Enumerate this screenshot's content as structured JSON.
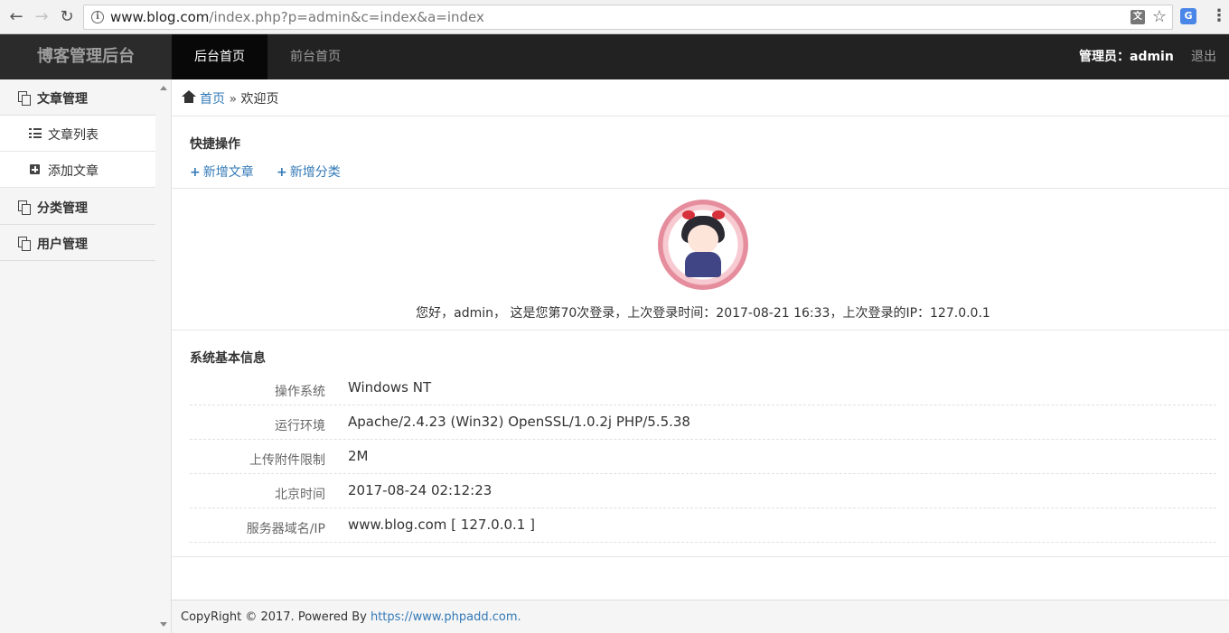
{
  "browser": {
    "url_host": "www.blog.com",
    "url_path": "/index.php?p=admin&c=index&a=index"
  },
  "header": {
    "brand": "博客管理后台",
    "nav": [
      {
        "label": "后台首页"
      },
      {
        "label": "前台首页"
      }
    ],
    "user": "管理员：admin",
    "logout": "退出"
  },
  "sidebar": {
    "groups": [
      {
        "label": "文章管理",
        "items": [
          {
            "label": "文章列表"
          },
          {
            "label": "添加文章"
          }
        ]
      },
      {
        "label": "分类管理"
      },
      {
        "label": "用户管理"
      }
    ]
  },
  "breadcrumb": {
    "home": "首页",
    "sep": "»",
    "current": "欢迎页"
  },
  "quick": {
    "title": "快捷操作",
    "links": [
      {
        "label": "新增文章"
      },
      {
        "label": "新增分类"
      }
    ]
  },
  "welcome": {
    "text": "您好，admin， 这是您第70次登录，上次登录时间：2017-08-21 16:33，上次登录的IP：127.0.0.1"
  },
  "sysinfo": {
    "title": "系统基本信息",
    "rows": [
      {
        "label": "操作系统",
        "value": "Windows NT"
      },
      {
        "label": "运行环境",
        "value": "Apache/2.4.23 (Win32) OpenSSL/1.0.2j PHP/5.5.38"
      },
      {
        "label": "上传附件限制",
        "value": "2M"
      },
      {
        "label": "北京时间",
        "value": "2017-08-24 02:12:23"
      },
      {
        "label": "服务器域名/IP",
        "value": "www.blog.com [ 127.0.0.1 ]"
      }
    ]
  },
  "footer": {
    "text": "CopyRight © 2017. Powered By ",
    "link": "https://www.phpadd.com."
  }
}
